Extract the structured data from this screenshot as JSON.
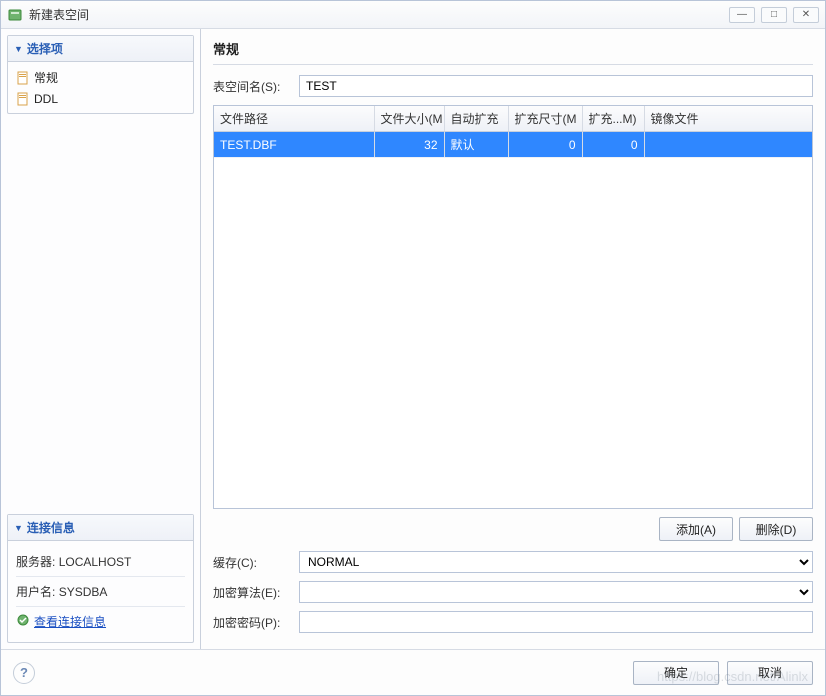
{
  "window": {
    "title": "新建表空间",
    "controls": {
      "min": "—",
      "max": "□",
      "close": "✕"
    }
  },
  "sidebar": {
    "options_header": "选择项",
    "items": [
      {
        "label": "常规",
        "icon": "page-icon"
      },
      {
        "label": "DDL",
        "icon": "page-icon"
      }
    ],
    "conn_header": "连接信息",
    "server_label": "服务器:",
    "server_value": "LOCALHOST",
    "user_label": "用户名:",
    "user_value": "SYSDBA",
    "view_conn_link": "查看连接信息"
  },
  "main": {
    "title": "常规",
    "ts_name_label": "表空间名(S):",
    "ts_name_value": "TEST",
    "columns": [
      "文件路径",
      "文件大小(M",
      "自动扩充",
      "扩充尺寸(M",
      "扩充...M)",
      "镜像文件"
    ],
    "rows": [
      {
        "path": "TEST.DBF",
        "size": "32",
        "auto": "默认",
        "ext_size": "0",
        "ext_max": "0",
        "mirror": ""
      }
    ],
    "add_btn": "添加(A)",
    "del_btn": "删除(D)",
    "cache_label": "缓存(C):",
    "cache_value": "NORMAL",
    "enc_algo_label": "加密算法(E):",
    "enc_algo_value": "",
    "enc_pwd_label": "加密密码(P):",
    "enc_pwd_value": ""
  },
  "footer": {
    "ok": "确定",
    "cancel": "取消"
  },
  "watermark": "https://blog.csdn.net/Alinlx"
}
